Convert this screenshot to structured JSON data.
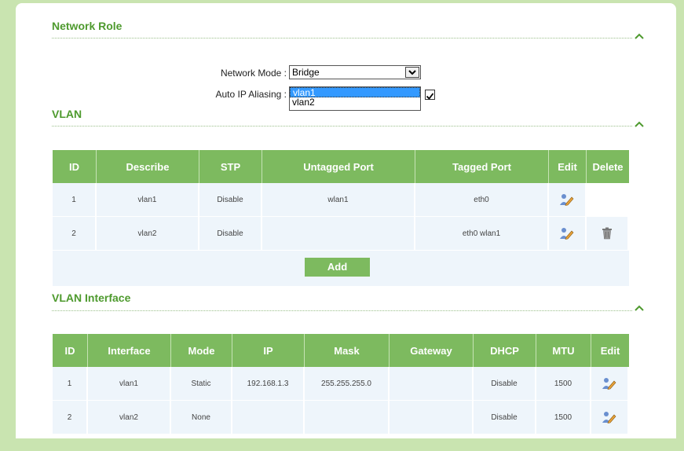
{
  "network_role": {
    "title": "Network Role",
    "mode_label": "Network Mode :",
    "mode_value": "Bridge",
    "alias_label": "Auto IP Aliasing :",
    "alias_options": [
      "vlan1",
      "vlan2"
    ],
    "alias_selected": "vlan1"
  },
  "vlan": {
    "title": "VLAN",
    "headers": [
      "ID",
      "Describe",
      "STP",
      "Untagged Port",
      "Tagged Port",
      "Edit",
      "Delete"
    ],
    "rows": [
      {
        "id": "1",
        "describe": "vlan1",
        "stp": "Disable",
        "untagged": "wlan1",
        "tagged": "eth0"
      },
      {
        "id": "2",
        "describe": "vlan2",
        "stp": "Disable",
        "untagged": "",
        "tagged": "eth0 wlan1"
      }
    ],
    "add_label": "Add"
  },
  "vlan_interface": {
    "title": "VLAN Interface",
    "headers": [
      "ID",
      "Interface",
      "Mode",
      "IP",
      "Mask",
      "Gateway",
      "DHCP",
      "MTU",
      "Edit"
    ],
    "rows": [
      {
        "id": "1",
        "interface": "vlan1",
        "mode": "Static",
        "ip": "192.168.1.3",
        "mask": "255.255.255.0",
        "gateway": "",
        "dhcp": "Disable",
        "mtu": "1500"
      },
      {
        "id": "2",
        "interface": "vlan2",
        "mode": "None",
        "ip": "",
        "mask": "",
        "gateway": "",
        "dhcp": "Disable",
        "mtu": "1500"
      }
    ]
  },
  "colors": {
    "accent": "#4e9a2e",
    "header_bg": "#7dba5f",
    "row_bg": "#eef5fb",
    "frame_bg": "#c9e4b0"
  },
  "icons": {
    "collapse": "chevron-up-icon",
    "edit": "edit-pencil-icon",
    "delete": "trash-icon",
    "checkbox": "checkmark-icon"
  }
}
